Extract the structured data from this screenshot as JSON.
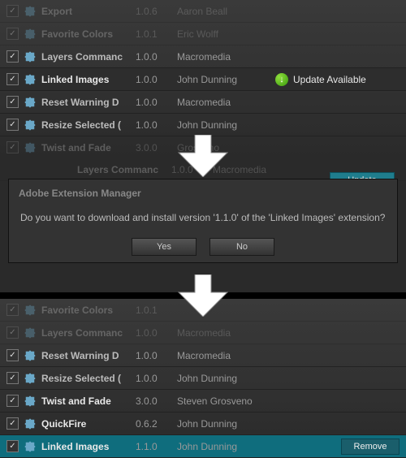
{
  "top": {
    "rows": [
      {
        "name": "Export",
        "ver": "1.0.6",
        "author": "Aaron Beall",
        "faded": true
      },
      {
        "name": "Favorite Colors",
        "ver": "1.0.1",
        "author": "Eric Wolff",
        "faded": true
      },
      {
        "name": "Layers Commanc",
        "ver": "1.0.0",
        "author": "Macromedia"
      },
      {
        "name": "Linked Images",
        "ver": "1.0.0",
        "author": "John Dunning",
        "sel": true,
        "update": true
      },
      {
        "name": "Reset Warning D",
        "ver": "1.0.0",
        "author": "Macromedia"
      },
      {
        "name": "Resize Selected (",
        "ver": "1.0.0",
        "author": "John Dunning"
      },
      {
        "name": "Twist and Fade",
        "ver": "3.0.0",
        "author": "Grosveno",
        "faded": true
      }
    ],
    "update_label": "Update Available"
  },
  "middle": {
    "strip_name": "Layers Commanc",
    "strip_ver": "1.0.0",
    "strip_author": "Macromedia",
    "update_btn": "Update",
    "dialog_title": "Adobe Extension Manager",
    "dialog_body": "Do you want to download and install version '1.1.0' of the 'Linked Images' extension?",
    "yes": "Yes",
    "no": "No"
  },
  "bottom": {
    "rows": [
      {
        "name": "Favorite Colors",
        "ver": "1.0.1",
        "author": "",
        "faded": true
      },
      {
        "name": "Layers Commanc",
        "ver": "1.0.0",
        "author": "Macromedia",
        "faded": true
      },
      {
        "name": "Reset Warning D",
        "ver": "1.0.0",
        "author": "Macromedia"
      },
      {
        "name": "Resize Selected (",
        "ver": "1.0.0",
        "author": "John Dunning"
      },
      {
        "name": "Twist and Fade",
        "ver": "3.0.0",
        "author": "Steven Grosveno",
        "bold": true
      },
      {
        "name": "QuickFire",
        "ver": "0.6.2",
        "author": "John Dunning",
        "bold": true
      },
      {
        "name": "Linked Images",
        "ver": "1.1.0",
        "author": "John Dunning",
        "hl": true,
        "remove": true
      }
    ],
    "remove": "Remove"
  }
}
